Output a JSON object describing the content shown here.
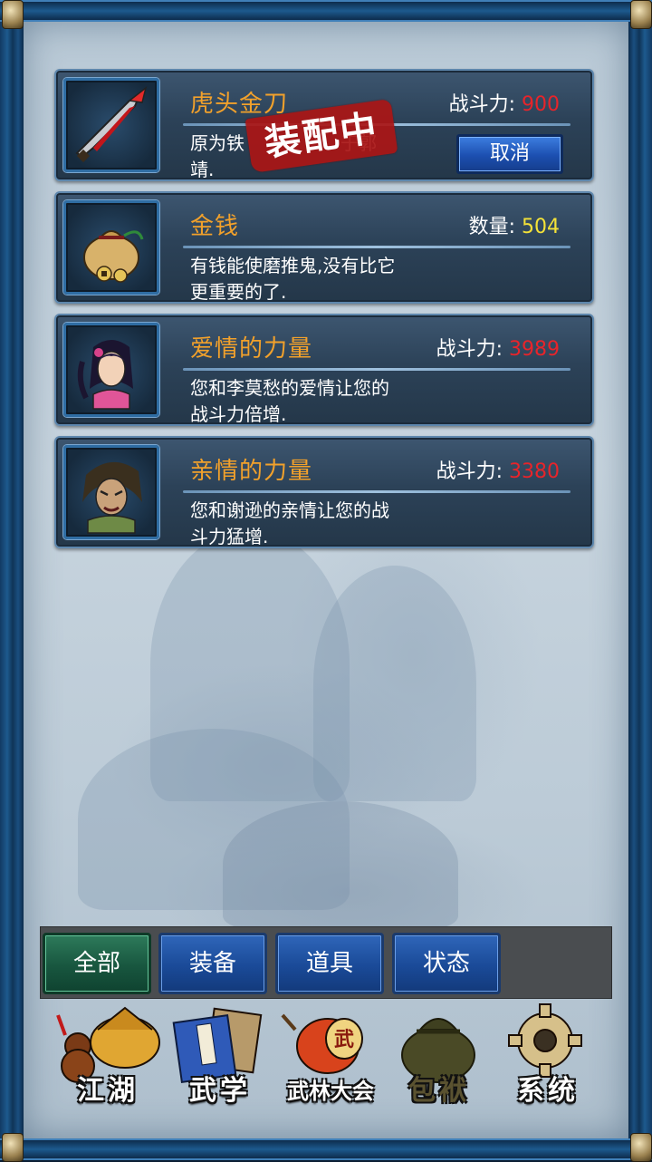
{
  "items": [
    {
      "name": "虎头金刀",
      "stat_label": "战斗力:",
      "stat_value": "900",
      "desc_line1": "原为铁",
      "desc_line1_end": "于郭",
      "desc_line2": "靖.",
      "equipped_stamp": "装配中",
      "action_label": "取消",
      "icon": "sword-icon"
    },
    {
      "name": "金钱",
      "stat_label": "数量:",
      "stat_value": "504",
      "desc_line1": "有钱能使磨推鬼,没有比它",
      "desc_line2": "更重要的了.",
      "icon": "money-bag-icon"
    },
    {
      "name": "爱情的力量",
      "stat_label": "战斗力:",
      "stat_value": "3989",
      "desc_line1": "您和李莫愁的爱情让您的",
      "desc_line2": "战斗力倍增.",
      "icon": "female-portrait-icon"
    },
    {
      "name": "亲情的力量",
      "stat_label": "战斗力:",
      "stat_value": "3380",
      "desc_line1": "您和谢逊的亲情让您的战",
      "desc_line2": "斗力猛增.",
      "icon": "male-portrait-icon"
    }
  ],
  "tabs": [
    {
      "label": "全部",
      "active": true
    },
    {
      "label": "装备",
      "active": false
    },
    {
      "label": "道具",
      "active": false
    },
    {
      "label": "状态",
      "active": false
    }
  ],
  "nav": [
    {
      "label": "江湖",
      "icon": "gourd-hat-icon"
    },
    {
      "label": "武学",
      "icon": "book-icon"
    },
    {
      "label": "武林大会",
      "icon": "drum-icon"
    },
    {
      "label": "包袱",
      "icon": "bag-icon",
      "selected": true
    },
    {
      "label": "系统",
      "icon": "gear-icon"
    }
  ],
  "colors": {
    "item_name": "#f2a12b",
    "combat_value": "#e8242a",
    "quantity_value": "#f4e238",
    "stamp": "#aa1616"
  }
}
